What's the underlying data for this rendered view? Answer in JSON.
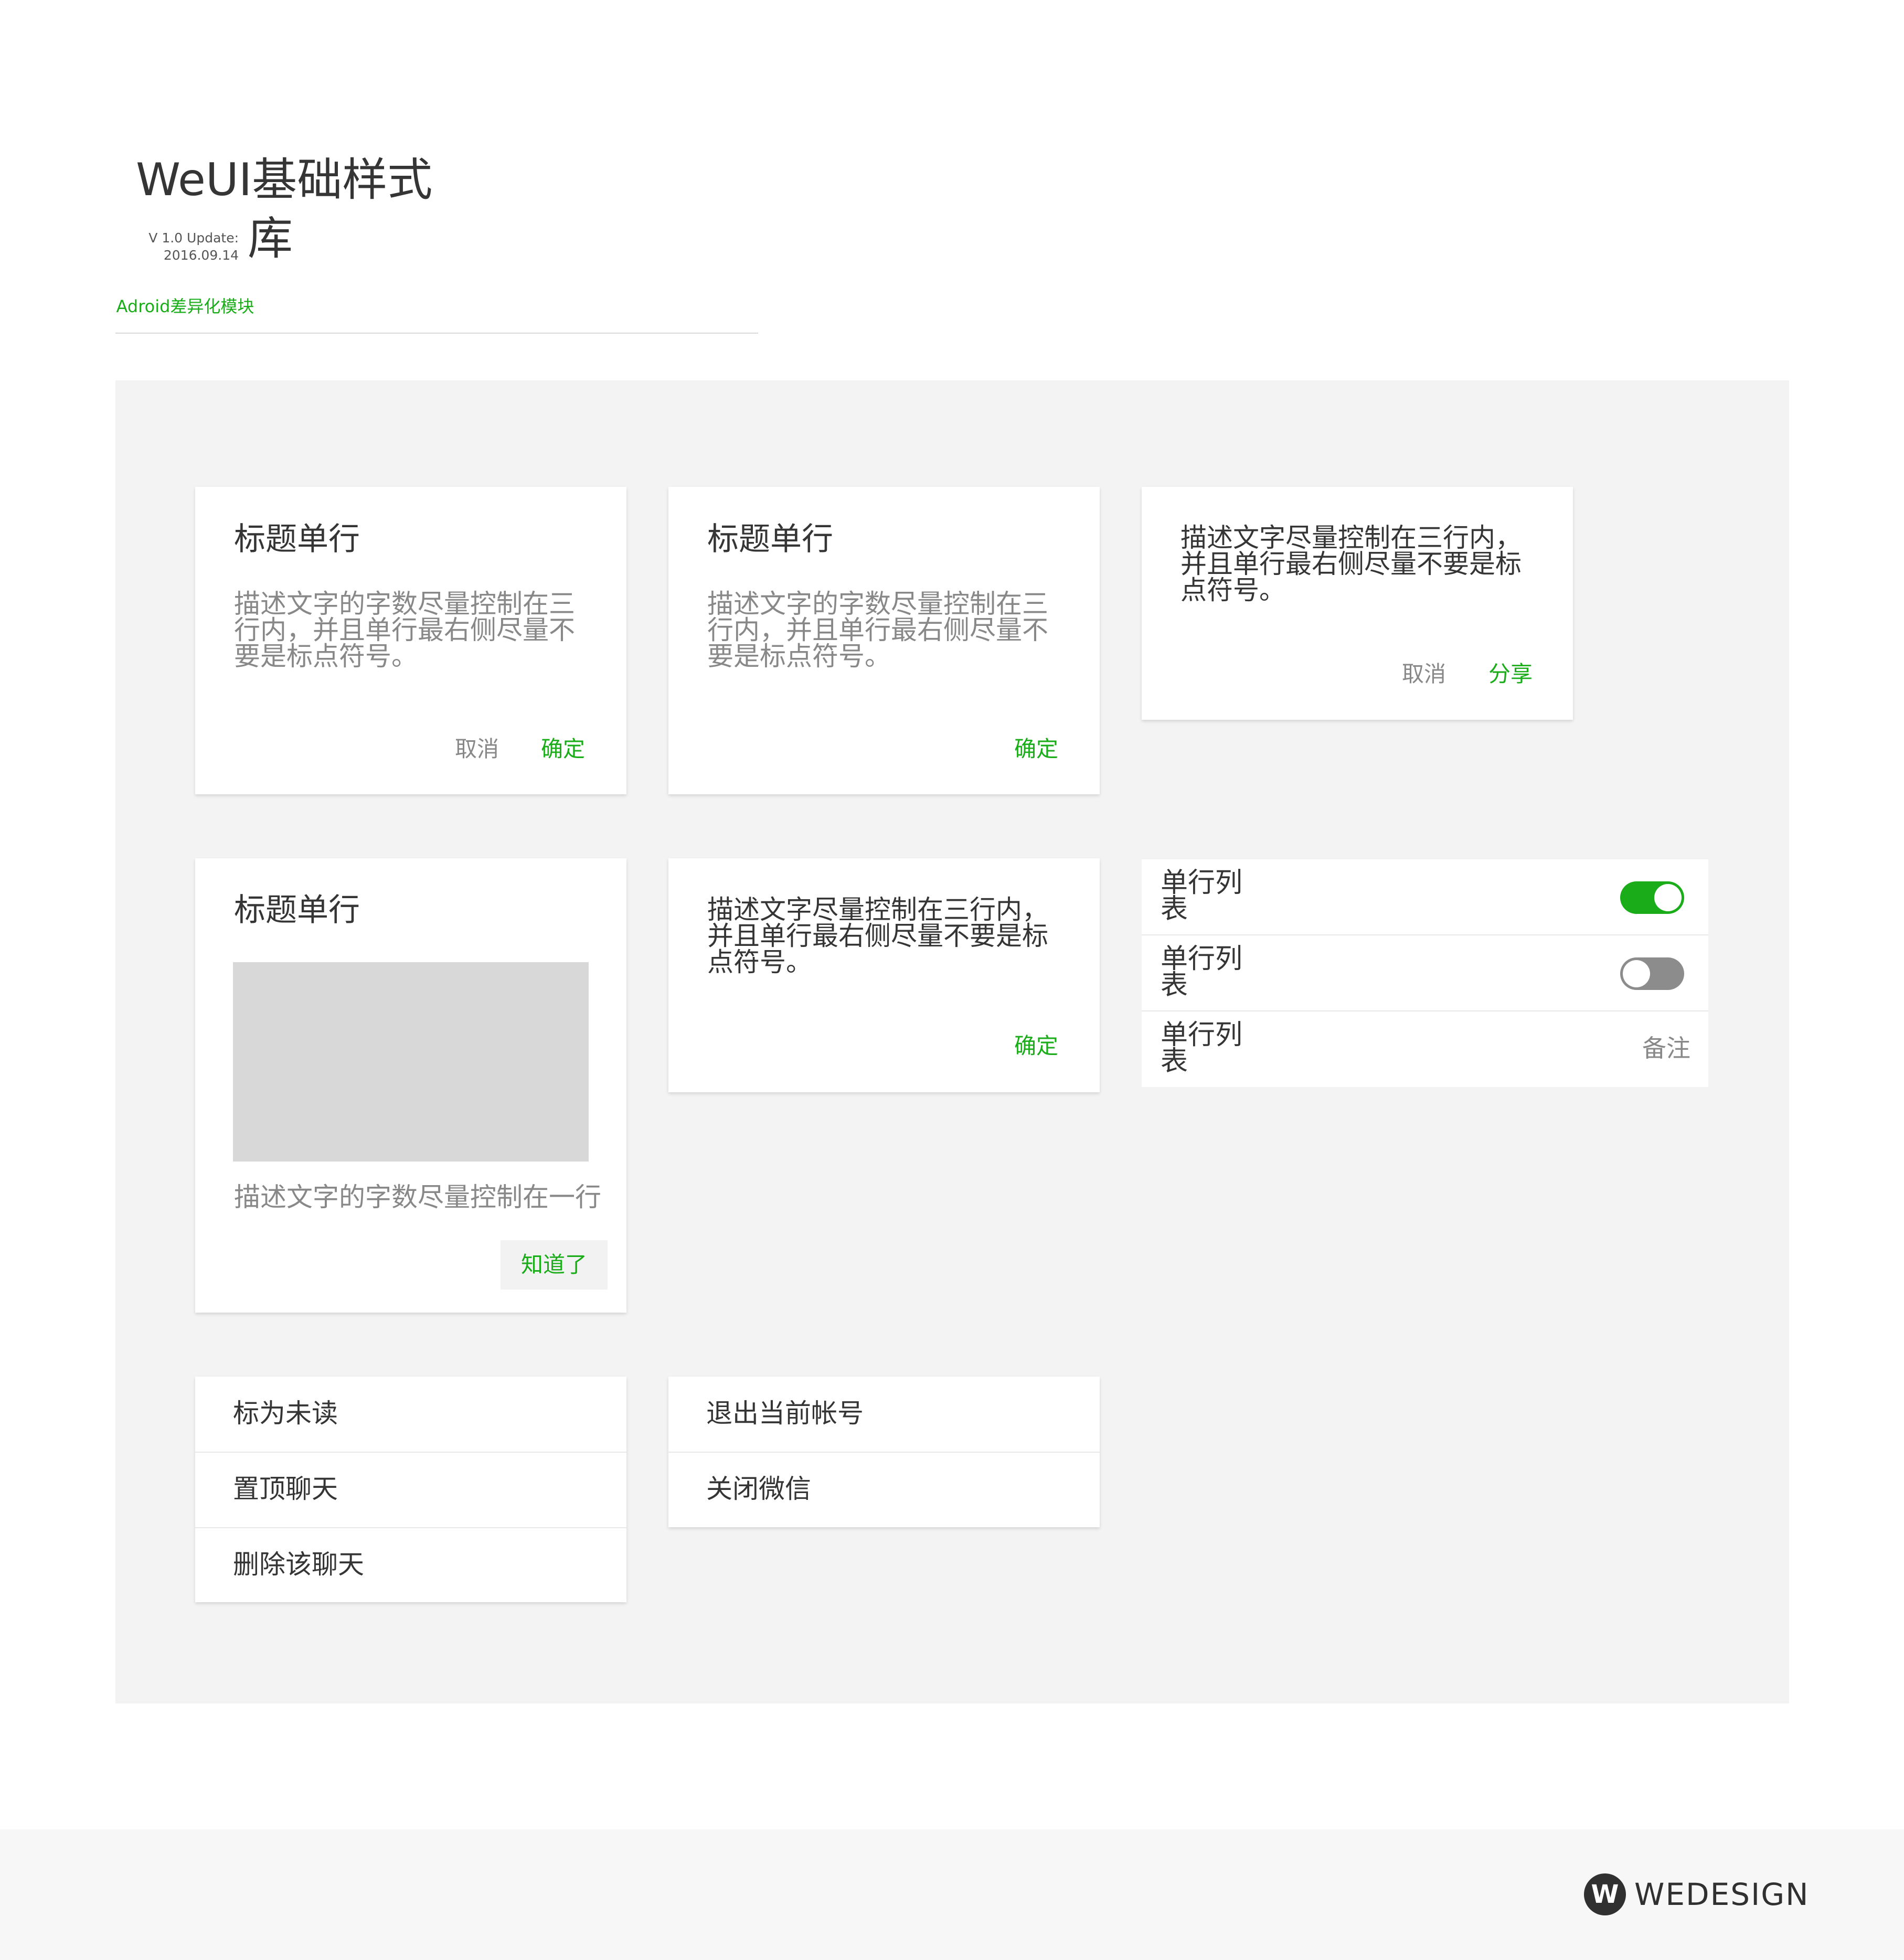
{
  "header": {
    "title_line1": "WeUI基础样式",
    "title_line2": "库",
    "version_line1": "V 1.0  Update:",
    "version_line2": "2016.09.14",
    "module": "Adroid差异化模块"
  },
  "dialogs": {
    "d1": {
      "title": "标题单行",
      "desc": "描述文字的字数尽量控制在三行内，并且单行最右侧尽量不要是标点符号。",
      "cancel": "取消",
      "confirm": "确定"
    },
    "d2": {
      "title": "标题单行",
      "desc": "描述文字的字数尽量控制在三行内，并且单行最右侧尽量不要是标点符号。",
      "confirm": "确定"
    },
    "d3": {
      "desc": "描述文字尽量控制在三行内，并且单行最右侧尽量不要是标点符号。",
      "cancel": "取消",
      "confirm": "分享"
    },
    "d4": {
      "title": "标题单行",
      "desc": "描述文字的字数尽量控制在一行",
      "confirm": "知道了"
    },
    "d5": {
      "desc": "描述文字尽量控制在三行内，并且单行最右侧尽量不要是标点符号。",
      "confirm": "确定"
    }
  },
  "list": {
    "items": [
      {
        "label": "单行列表",
        "switch_on": true
      },
      {
        "label": "单行列表",
        "switch_on": false
      },
      {
        "label": "单行列表",
        "note": "备注"
      }
    ]
  },
  "menu1": {
    "items": [
      "标为未读",
      "置顶聊天",
      "删除该聊天"
    ]
  },
  "menu2": {
    "items": [
      "退出当前帐号",
      "关闭微信"
    ]
  },
  "footer": {
    "brand": "WEDESIGN",
    "logo_letter": "W"
  },
  "colors": {
    "accent": "#1aad19",
    "panel": "#f3f3f3",
    "text": "#353535",
    "muted": "#888888"
  }
}
